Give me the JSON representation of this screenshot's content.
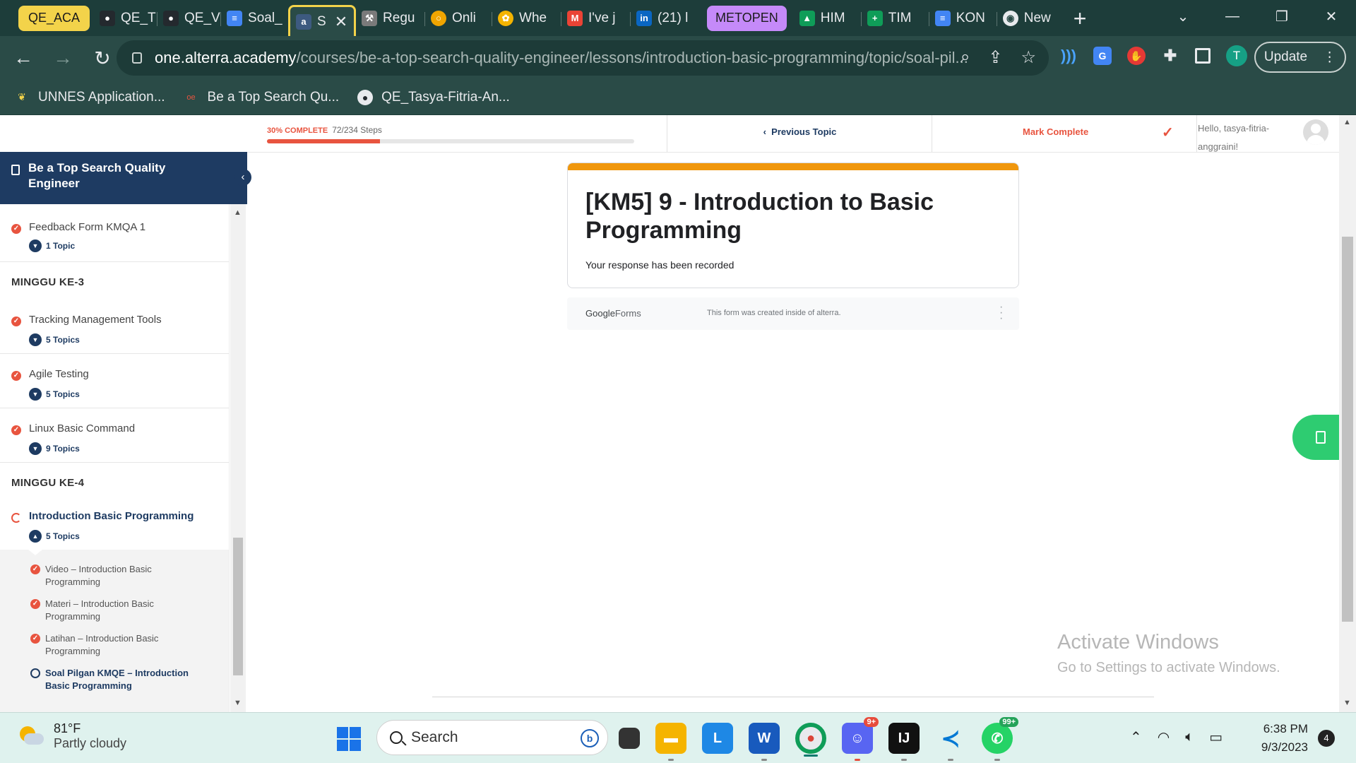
{
  "browser": {
    "tabs": [
      {
        "label": "QE_ACA",
        "group": "yellow"
      },
      {
        "label": "QE_T",
        "icon": "github-icon"
      },
      {
        "label": "QE_V",
        "icon": "github-icon"
      },
      {
        "label": "Soal_",
        "icon": "docs-icon"
      },
      {
        "label": "S",
        "icon": "alterra-icon",
        "active": true
      },
      {
        "label": "Regu",
        "icon": "wrench-icon"
      },
      {
        "label": "Onli",
        "icon": "circle-icon"
      },
      {
        "label": "Whe",
        "icon": "wheel-icon"
      },
      {
        "label": "I've j",
        "icon": "gmail-icon"
      },
      {
        "label": "(21) l",
        "icon": "linkedin-icon"
      },
      {
        "label": "METOPEN",
        "group": "purple"
      },
      {
        "label": "HIM",
        "icon": "drive-icon"
      },
      {
        "label": "TIM",
        "icon": "sheets-icon"
      },
      {
        "label": "KON",
        "icon": "docs-icon"
      },
      {
        "label": "New",
        "icon": "chrome-icon"
      }
    ],
    "new_tab": "+",
    "url_host": "one.alterra.academy",
    "url_path": "/courses/be-a-top-search-quality-engineer/lessons/introduction-basic-programming/topic/soal-pil...",
    "update_label": "Update",
    "profile_initial": "T",
    "bookmarks": [
      {
        "label": "UNNES Application...",
        "icon": "unnes-icon"
      },
      {
        "label": "Be a Top Search Qu...",
        "icon": "alterra-icon"
      },
      {
        "label": "QE_Tasya-Fitria-An...",
        "icon": "github-icon"
      }
    ]
  },
  "header": {
    "progress_percent_label": "30% COMPLETE",
    "progress_steps": "72/234 Steps",
    "progress_value": 0.3077,
    "previous_topic": "Previous Topic",
    "mark_complete": "Mark Complete",
    "greeting": "Hello, tasya-fitria-anggraini!"
  },
  "sidebar": {
    "course_title": "Be a Top Search Quality Engineer",
    "lessons_top": [
      {
        "name": "Feedback Form KMQA 1",
        "topics": "1 Topic"
      }
    ],
    "week3": "MINGGU KE-3",
    "lessons_week3": [
      {
        "name": "Tracking Management Tools",
        "topics": "5 Topics"
      },
      {
        "name": "Agile Testing",
        "topics": "5 Topics"
      },
      {
        "name": "Linux Basic Command",
        "topics": "9 Topics"
      }
    ],
    "week4": "MINGGU KE-4",
    "current_lesson": {
      "name": "Introduction Basic Programming",
      "topics": "5 Topics"
    },
    "topic_items": [
      {
        "name": "Video – Introduction Basic Programming",
        "done": true
      },
      {
        "name": "Materi – Introduction Basic Programming",
        "done": true
      },
      {
        "name": "Latihan – Introduction Basic Programming",
        "done": true
      },
      {
        "name": "Soal Pilgan KMQE – Introduction Basic Programming",
        "done": false,
        "current": true
      }
    ]
  },
  "form": {
    "title": "[KM5] 9 - Introduction to Basic Programming",
    "message": "Your response has been recorded",
    "footer_brand_google": "Google",
    "footer_brand_forms": "Forms",
    "footer_note": "This form was created inside of alterra.",
    "accent_color": "#f0970d"
  },
  "watermark": {
    "line1": "Activate Windows",
    "line2": "Go to Settings to activate Windows."
  },
  "taskbar": {
    "temperature": "81°F",
    "condition": "Partly cloudy",
    "search_placeholder": "Search",
    "time": "6:38 PM",
    "date": "9/3/2023",
    "notification_count": "4",
    "discord_badge": "9+",
    "whatsapp_badge": "99+"
  },
  "colors": {
    "accent_orange": "#e8543f",
    "navy": "#1e3b62",
    "chrome_green": "#2a4b47"
  }
}
